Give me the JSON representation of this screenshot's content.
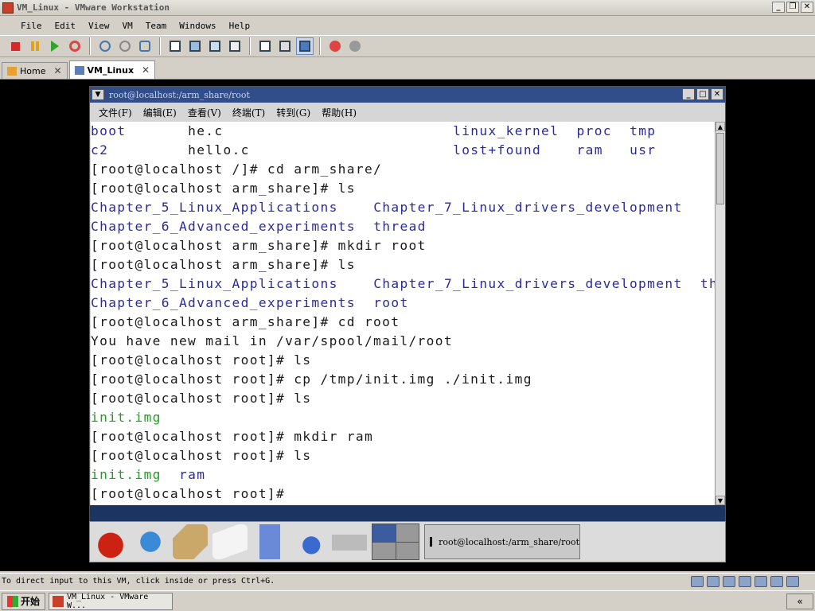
{
  "window": {
    "title": "VM_Linux - VMware Workstation",
    "minimize": "_",
    "maximize": "❐",
    "close": "✕"
  },
  "menubar": [
    {
      "label": "File"
    },
    {
      "label": "Edit"
    },
    {
      "label": "View"
    },
    {
      "label": "VM"
    },
    {
      "label": "Team"
    },
    {
      "label": "Windows"
    },
    {
      "label": "Help"
    }
  ],
  "toolbar": {
    "icons": [
      "stop-icon",
      "pause-icon",
      "play-icon",
      "reset-icon",
      "snapshot-icon",
      "revert-snapshot-icon",
      "snapshot-manager-icon",
      "normal-view-icon",
      "full-screen-icon",
      "quick-switch-icon",
      "summary-view-icon",
      "console-view-icon",
      "appliance-view-icon",
      "team-icon",
      "settings-icon"
    ],
    "colors": {
      "stop": "#d42a2a",
      "pause": "#e0a020",
      "play": "#2ea52e"
    }
  },
  "tabs": [
    {
      "label": "Home",
      "close": "✕",
      "active": false
    },
    {
      "label": "VM_Linux",
      "close": "✕",
      "active": true
    }
  ],
  "terminal": {
    "title": "root@localhost:/arm_share/root",
    "menu_button": "▼",
    "buttons": {
      "minimize": "_",
      "maximize": "□",
      "close": "✕"
    },
    "menu": [
      {
        "label": "文件(F)"
      },
      {
        "label": "编辑(E)"
      },
      {
        "label": "查看(V)"
      },
      {
        "label": "终端(T)"
      },
      {
        "label": "转到(G)"
      },
      {
        "label": "帮助(H)"
      }
    ],
    "scroll_up": "▲",
    "scroll_down": "▼",
    "lines": [
      [
        {
          "text": "boot",
          "color": "blue",
          "col": 0
        },
        {
          "text": "he.c",
          "color": "plain",
          "col": 11
        },
        {
          "text": "linux_kernel",
          "color": "blue",
          "col": 41
        },
        {
          "text": "proc",
          "color": "blue",
          "col": 55
        },
        {
          "text": "tmp",
          "color": "blue",
          "col": 61
        }
      ],
      [
        {
          "text": "c2",
          "color": "blue",
          "col": 0
        },
        {
          "text": "hello.c",
          "color": "plain",
          "col": 11
        },
        {
          "text": "lost+found",
          "color": "blue",
          "col": 41
        },
        {
          "text": "ram",
          "color": "blue",
          "col": 55
        },
        {
          "text": "usr",
          "color": "blue",
          "col": 61
        }
      ],
      [
        {
          "text": "[root@localhost /]# cd arm_share/",
          "color": "plain",
          "col": 0
        }
      ],
      [
        {
          "text": "[root@localhost arm_share]# ls",
          "color": "plain",
          "col": 0
        }
      ],
      [
        {
          "text": "Chapter_5_Linux_Applications",
          "color": "blue",
          "col": 0
        },
        {
          "text": "Chapter_7_Linux_drivers_development",
          "color": "blue",
          "col": 32
        }
      ],
      [
        {
          "text": "Chapter_6_Advanced_experiments",
          "color": "blue",
          "col": 0
        },
        {
          "text": "thread",
          "color": "blue",
          "col": 32
        }
      ],
      [
        {
          "text": "[root@localhost arm_share]# mkdir root",
          "color": "plain",
          "col": 0
        }
      ],
      [
        {
          "text": "[root@localhost arm_share]# ls",
          "color": "plain",
          "col": 0
        }
      ],
      [
        {
          "text": "Chapter_5_Linux_Applications",
          "color": "blue",
          "col": 0
        },
        {
          "text": "Chapter_7_Linux_drivers_development",
          "color": "blue",
          "col": 32
        },
        {
          "text": "thread",
          "color": "blue",
          "col": 69
        }
      ],
      [
        {
          "text": "Chapter_6_Advanced_experiments",
          "color": "blue",
          "col": 0
        },
        {
          "text": "root",
          "color": "blue",
          "col": 32
        }
      ],
      [
        {
          "text": "[root@localhost arm_share]# cd root",
          "color": "plain",
          "col": 0
        }
      ],
      [
        {
          "text": "You have new mail in /var/spool/mail/root",
          "color": "plain",
          "col": 0
        }
      ],
      [
        {
          "text": "[root@localhost root]# ls",
          "color": "plain",
          "col": 0
        }
      ],
      [
        {
          "text": "[root@localhost root]# cp /tmp/init.img ./init.img",
          "color": "plain",
          "col": 0
        }
      ],
      [
        {
          "text": "[root@localhost root]# ls",
          "color": "plain",
          "col": 0
        }
      ],
      [
        {
          "text": "init.img",
          "color": "green",
          "col": 0
        }
      ],
      [
        {
          "text": "[root@localhost root]# mkdir ram",
          "color": "plain",
          "col": 0
        }
      ],
      [
        {
          "text": "[root@localhost root]# ls",
          "color": "plain",
          "col": 0
        }
      ],
      [
        {
          "text": "init.img",
          "color": "green",
          "col": 0
        },
        {
          "text": "ram",
          "color": "blue",
          "col": 10
        }
      ],
      [
        {
          "text": "[root@localhost root]#",
          "color": "plain",
          "col": 0
        }
      ]
    ]
  },
  "panel": {
    "launchers": [
      "redhat-menu-icon",
      "web-browser-icon",
      "mail-icon",
      "writer-icon",
      "spreadsheet-icon",
      "presentation-icon",
      "printer-icon"
    ],
    "task": "root@localhost:/arm_share/root"
  },
  "status": {
    "text": "To direct input to this VM, click inside or press Ctrl+G."
  },
  "taskbar": {
    "start": "开始",
    "item": "VM_Linux - VMware W...",
    "tray": "«"
  }
}
